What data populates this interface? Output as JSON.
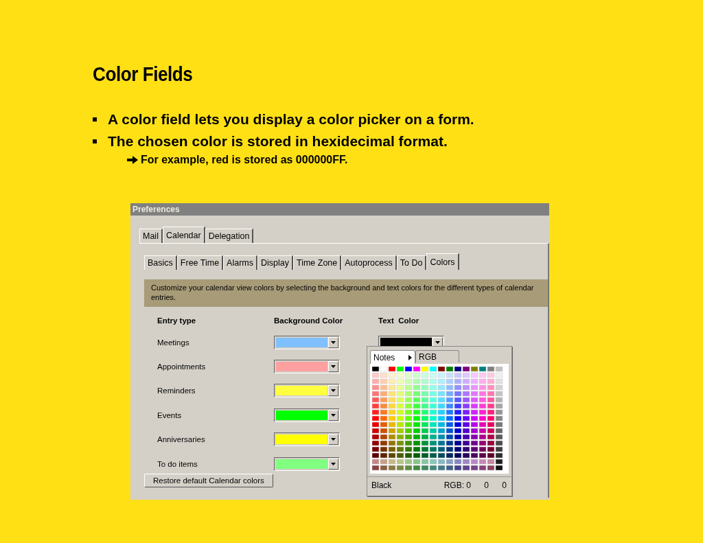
{
  "slide": {
    "title": "Color Fields",
    "bullets": [
      {
        "text": "A color field lets you display a color picker on a form."
      },
      {
        "text": "The chosen color is stored in hexidecimal format.",
        "children": [
          {
            "text": "For example, red is stored as 000000FF."
          }
        ]
      }
    ]
  },
  "window": {
    "title": "Preferences"
  },
  "tabs": [
    {
      "label": "Mail",
      "selected": false
    },
    {
      "label": "Calendar",
      "selected": true
    },
    {
      "label": "Delegation",
      "selected": false
    }
  ],
  "subtabs": [
    {
      "label": "Basics",
      "selected": false
    },
    {
      "label": "Free Time",
      "selected": false
    },
    {
      "label": "Alarms",
      "selected": false
    },
    {
      "label": "Display",
      "selected": false
    },
    {
      "label": "Time Zone",
      "selected": false
    },
    {
      "label": "Autoprocess",
      "selected": false
    },
    {
      "label": "To Do",
      "selected": false
    },
    {
      "label": "Colors",
      "selected": true
    }
  ],
  "description": "Customize your calendar view colors by selecting the background and text colors for the different types of calendar entries.",
  "columns": [
    "Entry type",
    "Background Color",
    "Text  Color"
  ],
  "entries": [
    {
      "name": "Meetings",
      "background": {
        "color": "#80c0ff"
      },
      "text": {
        "color": "#000000"
      }
    },
    {
      "name": "Appointments",
      "background": {
        "color": "#ffa0a0"
      }
    },
    {
      "name": "Reminders",
      "background": {
        "color": "#ffff40"
      }
    },
    {
      "name": "Events",
      "background": {
        "color": "#00ff00"
      }
    },
    {
      "name": "Anniversaries",
      "background": {
        "color": "#ffff00"
      }
    },
    {
      "name": "To do items",
      "background": {
        "color": "#80ff80"
      }
    }
  ],
  "picker": {
    "tabs": [
      {
        "label": "Notes",
        "selected": true
      },
      {
        "label": "RGB",
        "selected": false
      }
    ],
    "color_name": "Black",
    "rgb_label": "RGB: 0",
    "g": "0",
    "b": "0"
  },
  "restore_button": "Restore default Calendar colors"
}
